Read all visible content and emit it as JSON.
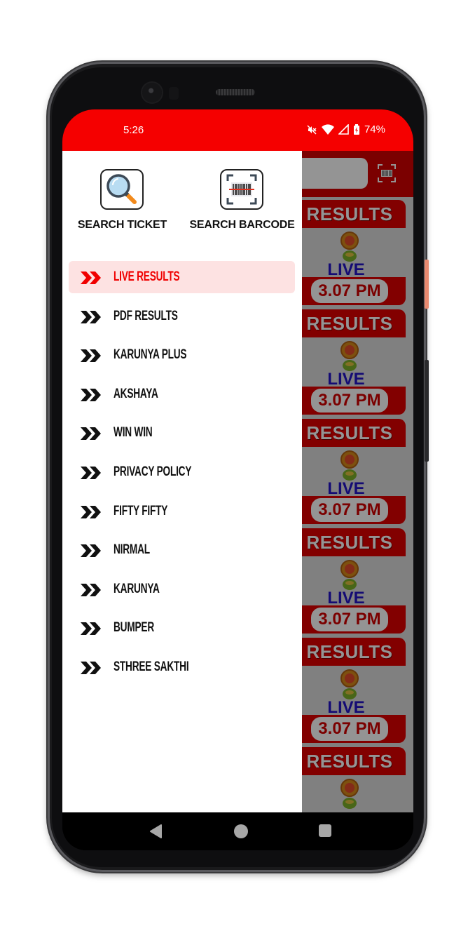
{
  "status_bar": {
    "time": "5:26",
    "battery": "74%",
    "icons": [
      "mute-icon",
      "wifi-icon",
      "signal-icon",
      "battery-charging-icon"
    ]
  },
  "colors": {
    "accent": "#f50000",
    "active_item_bg": "#fde2e2",
    "active_item_text": "#f00000",
    "live_text": "#2414c8"
  },
  "drawer": {
    "quick_actions": [
      {
        "label": "SEARCH TICKET",
        "icon": "magnifier-icon"
      },
      {
        "label": "SEARCH BARCODE",
        "icon": "barcode-scan-icon"
      }
    ],
    "menu_items": [
      {
        "label": "LIVE RESULTS",
        "active": true
      },
      {
        "label": "PDF RESULTS",
        "active": false
      },
      {
        "label": "KARUNYA PLUS",
        "active": false
      },
      {
        "label": "AKSHAYA",
        "active": false
      },
      {
        "label": "WIN WIN",
        "active": false
      },
      {
        "label": "PRIVACY POLICY",
        "active": false
      },
      {
        "label": "FIFTY FIFTY",
        "active": false
      },
      {
        "label": "NIRMAL",
        "active": false
      },
      {
        "label": "KARUNYA",
        "active": false
      },
      {
        "label": "BUMPER",
        "active": false
      },
      {
        "label": "STHREE SAKTHI",
        "active": false
      }
    ]
  },
  "background_app": {
    "cards": [
      {
        "title": "RESULTS",
        "status": "LIVE",
        "time": "3.07 PM"
      },
      {
        "title": "RESULTS",
        "status": "LIVE",
        "time": "3.07 PM"
      },
      {
        "title": "RESULTS",
        "status": "LIVE",
        "time": "3.07 PM"
      },
      {
        "title": "RESULTS",
        "status": "LIVE",
        "time": "3.07 PM"
      },
      {
        "title": "RESULTS",
        "status": "LIVE",
        "time": "3.07 PM"
      },
      {
        "title": "RESULTS",
        "status": "",
        "time": ""
      }
    ]
  },
  "nav_bar": {
    "buttons": [
      "back",
      "home",
      "recents"
    ]
  }
}
